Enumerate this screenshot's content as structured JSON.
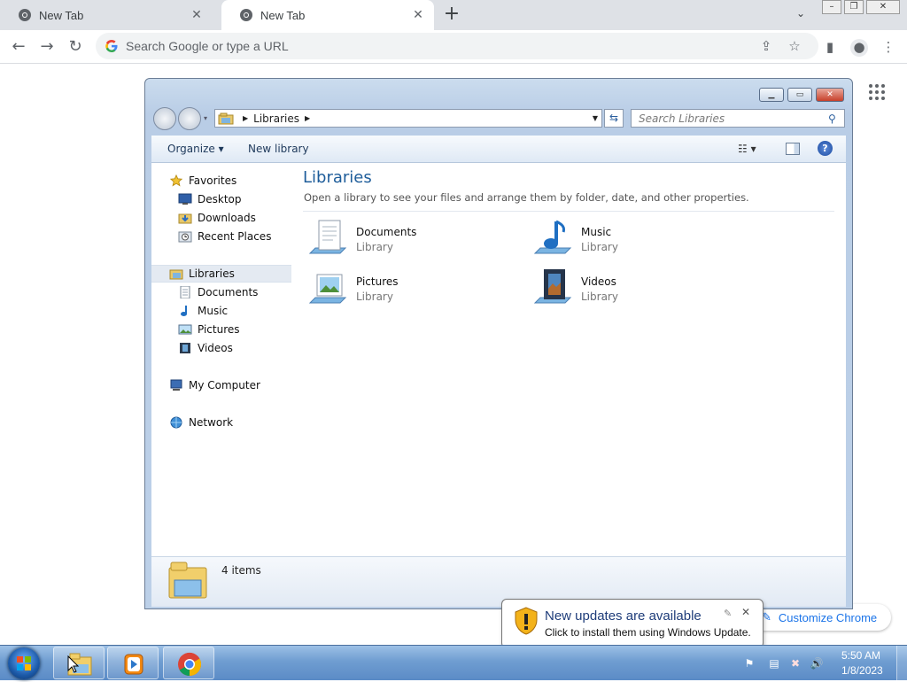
{
  "browser": {
    "tabs": [
      {
        "title": "New Tab",
        "active": false
      },
      {
        "title": "New Tab",
        "active": true
      }
    ],
    "new_tab_symbol": "+",
    "omnibox_placeholder": "Search Google or type a URL",
    "customize_label": "Customize Chrome"
  },
  "explorer": {
    "breadcrumb": "Libraries",
    "search_placeholder": "Search Libraries",
    "commands": {
      "organize": "Organize",
      "new_library": "New library"
    },
    "nav": {
      "favorites": {
        "label": "Favorites",
        "items": [
          "Desktop",
          "Downloads",
          "Recent Places"
        ]
      },
      "libraries": {
        "label": "Libraries",
        "items": [
          "Documents",
          "Music",
          "Pictures",
          "Videos"
        ]
      },
      "computer": "My Computer",
      "network": "Network"
    },
    "heading": "Libraries",
    "description": "Open a library to see your files and arrange them by folder, date, and other properties.",
    "libraries": [
      {
        "name": "Documents",
        "type": "Library",
        "icon": "documents-library-icon"
      },
      {
        "name": "Music",
        "type": "Library",
        "icon": "music-library-icon"
      },
      {
        "name": "Pictures",
        "type": "Library",
        "icon": "pictures-library-icon"
      },
      {
        "name": "Videos",
        "type": "Library",
        "icon": "videos-library-icon"
      }
    ],
    "status": "4 items"
  },
  "notification": {
    "title": "New updates are available",
    "body": "Click to install them using Windows Update."
  },
  "taskbar": {
    "time": "5:50 AM",
    "date": "1/8/2023",
    "pinned": [
      "windows-explorer-icon",
      "media-player-icon",
      "chrome-icon"
    ]
  },
  "colors": {
    "explorer_heading": "#1e5d9a",
    "chrome_link": "#1a73e8",
    "taskbar": "#6f9dd1"
  }
}
